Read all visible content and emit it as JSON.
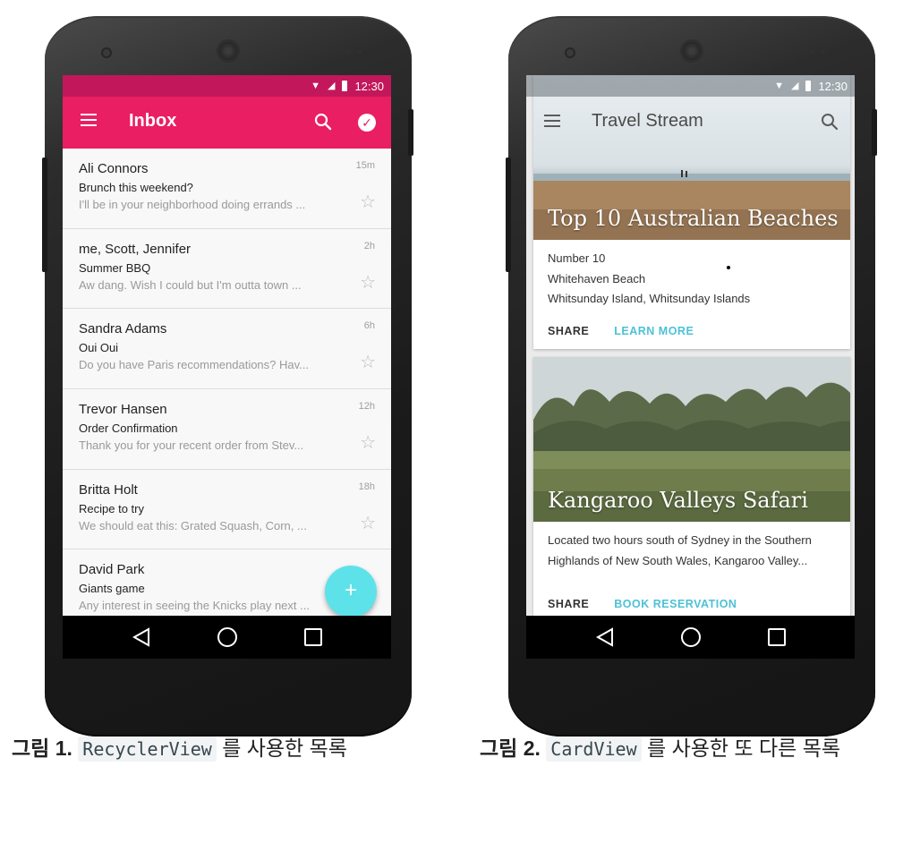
{
  "colors": {
    "inbox_appbar": "#e91e63",
    "inbox_statusbar": "#c2185b",
    "fab": "#5ee2ea",
    "link_accent": "#4dc1d6"
  },
  "left_phone": {
    "status_time": "12:30",
    "appbar": {
      "title": "Inbox",
      "menu_icon": "menu-icon",
      "search_icon": "search-icon",
      "check_icon": "check-circle-icon"
    },
    "emails": [
      {
        "sender": "Ali Connors",
        "subject": "Brunch this weekend?",
        "snippet": "I'll be in your neighborhood doing errands ...",
        "time": "15m"
      },
      {
        "sender": "me, Scott, Jennifer",
        "subject": "Summer BBQ",
        "snippet": "Aw dang. Wish I could but I'm outta town ...",
        "time": "2h"
      },
      {
        "sender": "Sandra Adams",
        "subject": "Oui Oui",
        "snippet": "Do you have Paris recommendations? Hav...",
        "time": "6h"
      },
      {
        "sender": "Trevor Hansen",
        "subject": "Order Confirmation",
        "snippet": "Thank you for your recent order from Stev...",
        "time": "12h"
      },
      {
        "sender": "Britta Holt",
        "subject": "Recipe to try",
        "snippet": "We should eat this: Grated Squash, Corn, ...",
        "time": "18h"
      },
      {
        "sender": "David Park",
        "subject": "Giants game",
        "snippet": "Any interest in seeing the Knicks play next ...",
        "time": ""
      }
    ],
    "fab_label": "+"
  },
  "right_phone": {
    "status_time": "12:30",
    "appbar": {
      "title": "Travel Stream"
    },
    "cards": [
      {
        "hero_title": "Top 10 Australian Beaches",
        "lines": [
          "Number 10",
          "Whitehaven Beach",
          "Whitsunday Island, Whitsunday Islands"
        ],
        "share": "SHARE",
        "action": "LEARN MORE"
      },
      {
        "hero_title": "Kangaroo Valleys Safari",
        "lines": [
          "Located two hours south of Sydney in the Southern",
          "Highlands of New South Wales, Kangaroo Valley..."
        ],
        "share": "SHARE",
        "action": "BOOK RESERVATION"
      }
    ]
  },
  "captions": {
    "c1": {
      "label": "그림 1.",
      "code": "RecyclerView",
      "text": "를 사용한 목록"
    },
    "c2": {
      "label": "그림 2.",
      "code": "CardView",
      "text": "를 사용한 또 다른 목록"
    }
  }
}
